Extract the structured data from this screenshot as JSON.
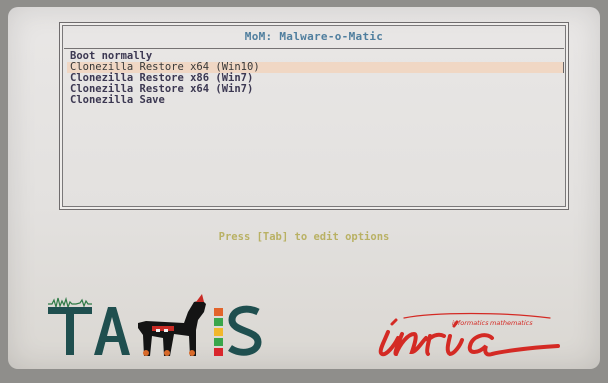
{
  "menu": {
    "title": "MoM: Malware-o-Matic",
    "items": [
      {
        "label": "Boot normally",
        "selected": false
      },
      {
        "label": "Clonezilla Restore x64 (Win10)",
        "selected": true
      },
      {
        "label": "Clonezilla Restore x86 (Win7)",
        "selected": false
      },
      {
        "label": "Clonezilla Restore x64 (Win7)",
        "selected": false
      },
      {
        "label": "Clonezilla Save",
        "selected": false
      }
    ]
  },
  "hint": "Press [Tab] to edit options",
  "logos": {
    "tamis": {
      "letters_left": "TA",
      "letters_right": "S"
    },
    "inria": {
      "wordmark": "inria",
      "tagline_left": "informatics",
      "tagline_right": "mathematics"
    }
  },
  "colors": {
    "title_blue": "#4f7e9e",
    "item_text": "#3c3852",
    "selection_bg": "#f0d7c4",
    "hint_yellow": "#b9b164",
    "tamis_teal": "#1f4f4f",
    "inria_red": "#d42a24"
  }
}
